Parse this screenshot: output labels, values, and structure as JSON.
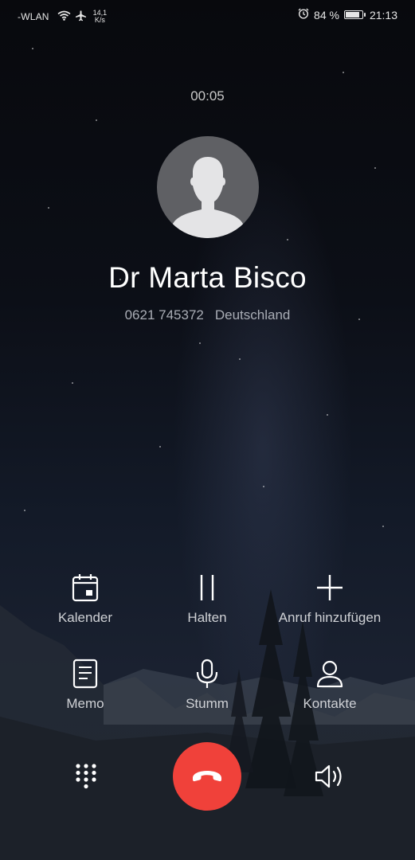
{
  "status_bar": {
    "network_label": "-WLAN",
    "speed_value": "14,1",
    "speed_unit": "K/s",
    "battery": "84 %",
    "battery_level": 0.84,
    "time": "21:13",
    "icons": [
      "wifi-icon",
      "airplane-icon",
      "alarm-icon",
      "battery-icon"
    ]
  },
  "call": {
    "duration": "00:05",
    "caller_name": "Dr Marta Bisco",
    "phone_number": "0621 745372",
    "location": "Deutschland"
  },
  "actions": [
    {
      "label": "Kalender",
      "icon": "calendar-icon"
    },
    {
      "label": "Halten",
      "icon": "pause-icon"
    },
    {
      "label": "Anruf hinzufügen",
      "icon": "plus-icon"
    },
    {
      "label": "Memo",
      "icon": "memo-icon"
    },
    {
      "label": "Stumm",
      "icon": "microphone-icon"
    },
    {
      "label": "Kontakte",
      "icon": "contact-icon"
    }
  ],
  "bottom_controls": {
    "dialpad_icon": "dialpad-icon",
    "hangup_icon": "hangup-icon",
    "speaker_icon": "speaker-icon",
    "hangup_color": "#f0413a"
  }
}
